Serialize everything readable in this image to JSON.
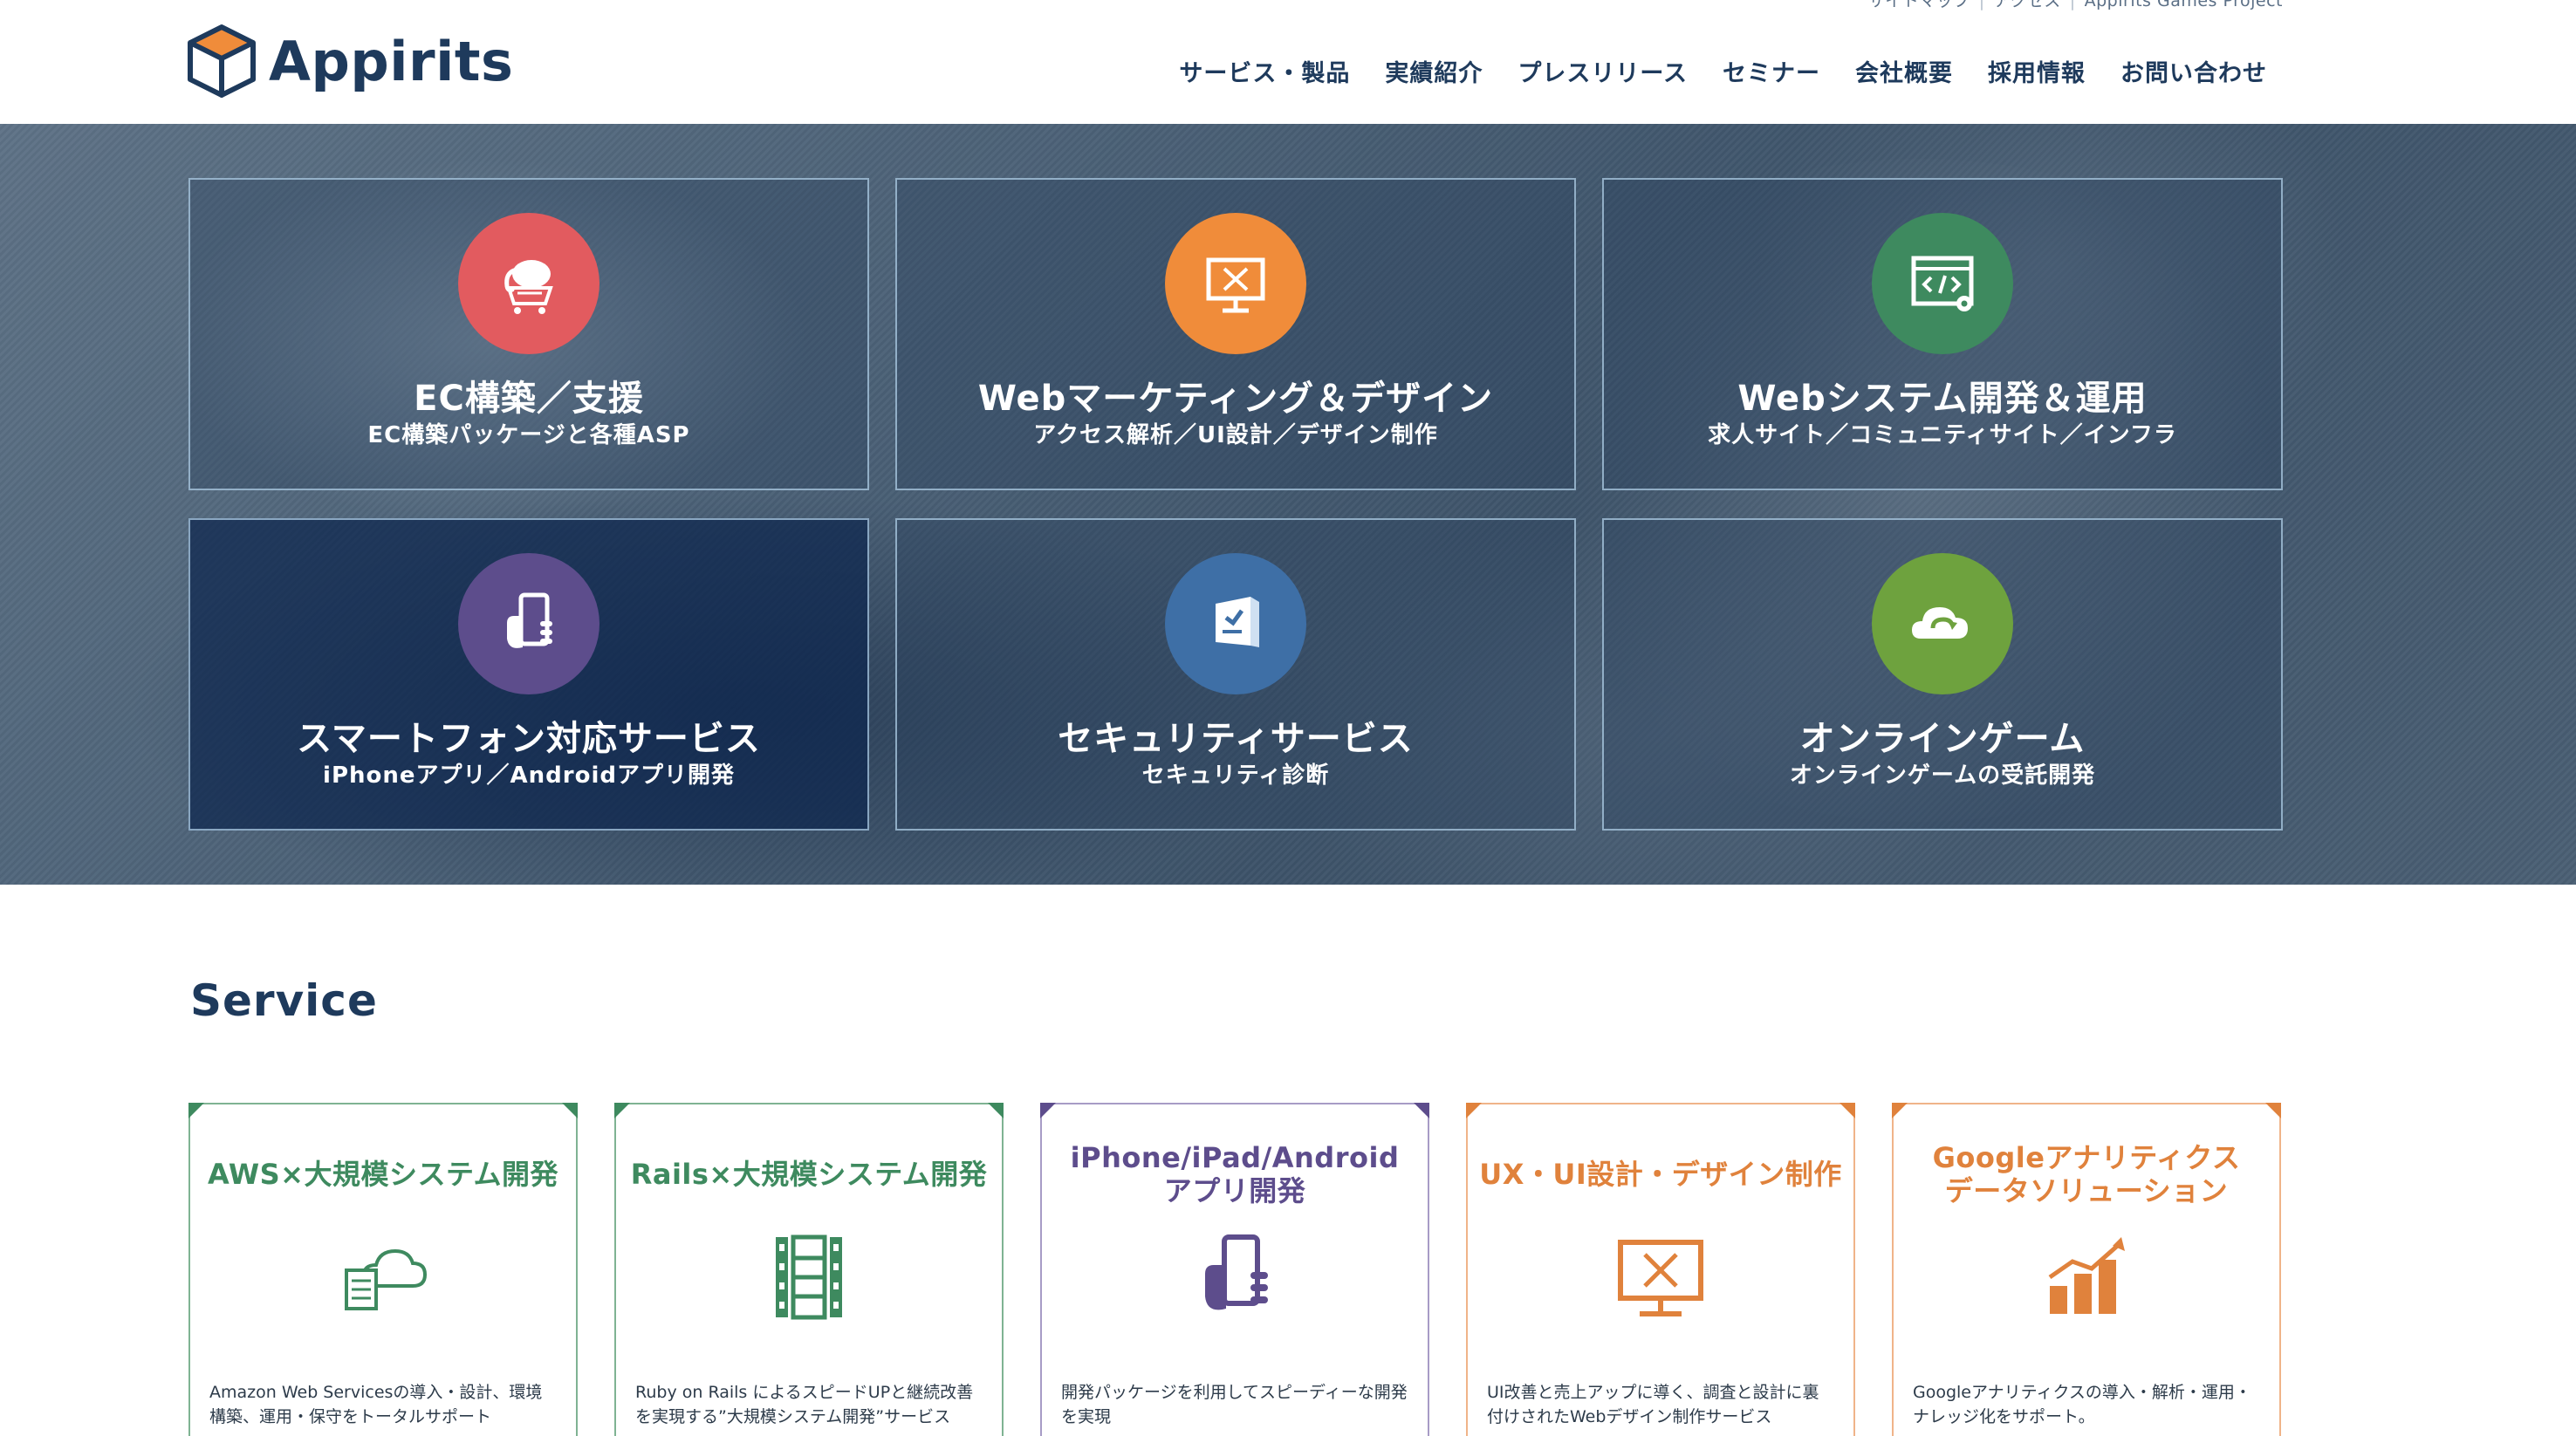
{
  "header": {
    "logo_text": "Appirits",
    "utility_links": [
      "サイトマップ",
      "アクセス",
      "Appirits Games Project"
    ],
    "nav": [
      "サービス・製品",
      "実績紹介",
      "プレスリリース",
      "セミナー",
      "会社概要",
      "採用情報",
      "お問い合わせ"
    ]
  },
  "hero": {
    "tiles": [
      {
        "title": "EC構築／支援",
        "sub": "EC構築パッケージと各種ASP",
        "icon": "shopping-cart-elephant-icon",
        "color": "#e25b5f"
      },
      {
        "title": "Webマーケティング＆デザイン",
        "sub": "アクセス解析／UI設計／デザイン制作",
        "icon": "monitor-design-icon",
        "color": "#f08c3a"
      },
      {
        "title": "Webシステム開発＆運用",
        "sub": "求人サイト／コミュニティサイト／インフラ",
        "icon": "code-window-icon",
        "color": "#3e8a5f"
      },
      {
        "title": "スマートフォン対応サービス",
        "sub": "iPhoneアプリ／Androidアプリ開発",
        "icon": "smartphone-hand-icon",
        "color": "#5d4d8c"
      },
      {
        "title": "セキュリティサービス",
        "sub": "セキュリティ診断",
        "icon": "security-shield-icon",
        "color": "#3e6fa6"
      },
      {
        "title": "オンラインゲーム",
        "sub": "オンラインゲームの受託開発",
        "icon": "cloud-game-icon",
        "color": "#6ea23e"
      }
    ]
  },
  "service": {
    "heading": "Service",
    "cards": [
      {
        "title": "AWS×大規模システム開発",
        "desc": "Amazon Web Servicesの導入・設計、環境構築、運用・保守をトータルサポート",
        "color": "#3e8a5f",
        "icon": "cloud-server-icon"
      },
      {
        "title": "Rails×大規模システム開発",
        "desc": "Ruby on Rails によるスピードUPと継続改善を実現する”大規模システム開発”サービス",
        "color": "#3e8a5f",
        "icon": "film-strip-icon"
      },
      {
        "title": "iPhone/iPad/Android\nアプリ開発",
        "desc": "開発パッケージを利用してスピーディーな開発を実現",
        "color": "#5d4d8c",
        "icon": "smartphone-hand-icon"
      },
      {
        "title": "UX・UI設計・デザイン制作",
        "desc": "UI改善と売上アップに導く、調査と設計に裏付けされたWebデザイン制作サービス",
        "color": "#e0823c",
        "icon": "monitor-design-icon"
      },
      {
        "title": "Googleアナリティクス\nデータソリューション",
        "desc": "Googleアナリティクスの導入・解析・運用・ナレッジ化をサポート。",
        "color": "#e0823c",
        "icon": "bar-chart-growth-icon"
      }
    ]
  }
}
